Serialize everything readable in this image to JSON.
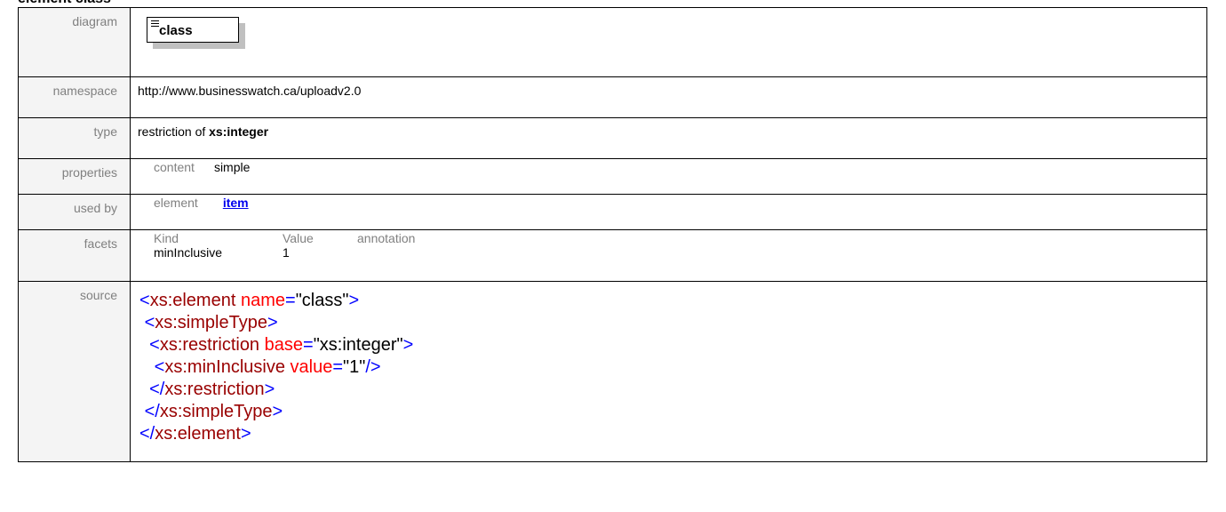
{
  "heading": "element class",
  "rows": {
    "diagram": {
      "label": "diagram",
      "element_name": "class"
    },
    "namespace": {
      "label": "namespace",
      "value": "http://www.businesswatch.ca/uploadv2.0"
    },
    "type": {
      "label": "type",
      "prefix": "restriction of",
      "base": "xs:integer"
    },
    "properties": {
      "label": "properties",
      "key": "content",
      "value": "simple"
    },
    "used_by": {
      "label": "used by",
      "kind": "element",
      "link": "item"
    },
    "facets": {
      "label": "facets",
      "headers": [
        "Kind",
        "Value",
        "annotation"
      ],
      "rows": [
        {
          "kind": "minInclusive",
          "value": "1",
          "annotation": ""
        }
      ]
    },
    "source": {
      "label": "source",
      "lines": [
        {
          "indent": "",
          "open": "<",
          "tag": "xs:element",
          "attr": "name",
          "eq": "=",
          "q1": "\"",
          "val": "class",
          "q2": "\"",
          "close": ">"
        },
        {
          "indent": " ",
          "open": "<",
          "tag": "xs:simpleType",
          "close": ">"
        },
        {
          "indent": "  ",
          "open": "<",
          "tag": "xs:restriction",
          "attr": "base",
          "eq": "=",
          "q1": "\"",
          "val": "xs:integer",
          "q2": "\"",
          "close": ">"
        },
        {
          "indent": "   ",
          "open": "<",
          "tag": "xs:minInclusive",
          "attr": "value",
          "eq": "=",
          "q1": "\"",
          "val": "1",
          "q2": "\"",
          "close": "/>"
        },
        {
          "indent": "  ",
          "open": "</",
          "tag": "xs:restriction",
          "close": ">"
        },
        {
          "indent": " ",
          "open": "</",
          "tag": "xs:simpleType",
          "close": ">"
        },
        {
          "indent": "",
          "open": "</",
          "tag": "xs:element",
          "close": ">"
        }
      ]
    }
  }
}
